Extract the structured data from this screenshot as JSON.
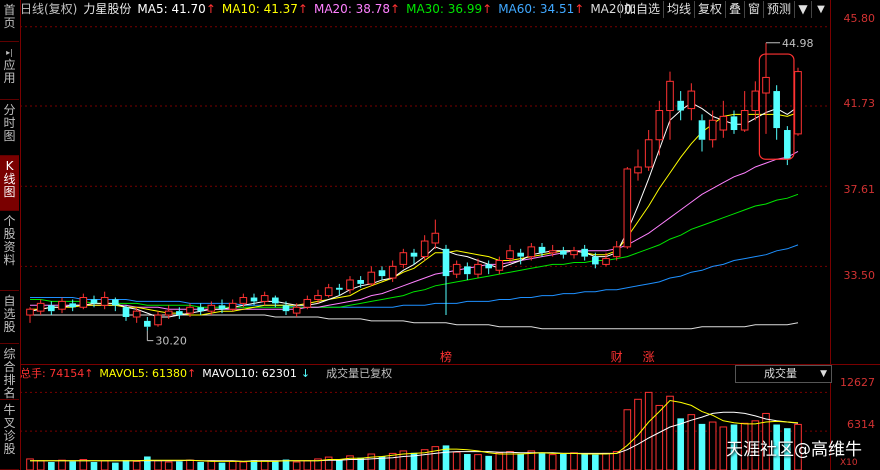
{
  "sidebar": {
    "items": [
      {
        "label": "首页",
        "active": false
      },
      {
        "label": "应用",
        "active": false,
        "prefix": "▸|"
      },
      {
        "label": "分时图",
        "active": false
      },
      {
        "label": "K线图",
        "active": true
      },
      {
        "label": "个股资料",
        "active": false
      },
      {
        "label": "自选股",
        "active": false
      },
      {
        "label": "综合排名",
        "active": false
      },
      {
        "label": "牛叉诊股",
        "active": false
      }
    ]
  },
  "header": {
    "period": "日线(复权)",
    "stock_name": "力星股份",
    "ma5": "MA5: 41.70",
    "ma10": "MA10: 41.37",
    "ma20": "MA20: 38.78",
    "ma30": "MA30: 36.99",
    "ma60": "MA60: 34.51",
    "ma200": "MA200:",
    "up_arrow": "↑"
  },
  "toolbar": {
    "buttons": [
      "加自选",
      "均线",
      "复权",
      "叠",
      "窗",
      "预测"
    ],
    "menu_icon": "▼"
  },
  "price_axis": {
    "labels": [
      "45.80",
      "41.73",
      "37.61",
      "33.50"
    ],
    "vol_labels": [
      "12627",
      "6314"
    ],
    "vol_unit": "X10"
  },
  "chart_annotations": {
    "high": "44.98",
    "low": "30.20",
    "markers": [
      "榜",
      "财",
      "涨"
    ]
  },
  "volume_header": {
    "total": "总手: 74154",
    "mavol5": "MAVOL5: 61380",
    "mavol10": "MAVOL10: 62301",
    "down_arrow": "↓",
    "note": "成交量已复权"
  },
  "volume_select": {
    "value": "成交量"
  },
  "watermark": "天涯社区@高维牛",
  "colors": {
    "up": "#ff3232",
    "down": "#54ffff",
    "ma5": "#ffffff",
    "ma10": "#ffff00",
    "ma20": "#ff80ff",
    "ma30": "#00e600",
    "ma60": "#1e90ff",
    "ma200": "#dcdcdc",
    "axis": "#d23232"
  },
  "chart_data": {
    "type": "candlestick",
    "ylim": [
      29.0,
      46.2
    ],
    "candles": [
      [
        31.0,
        31.3,
        30.6,
        31.4
      ],
      [
        31.2,
        31.6,
        31.0,
        31.8
      ],
      [
        31.5,
        31.2,
        31.0,
        31.7
      ],
      [
        31.3,
        31.7,
        31.1,
        31.9
      ],
      [
        31.6,
        31.4,
        31.2,
        31.8
      ],
      [
        31.4,
        31.9,
        31.3,
        32.1
      ],
      [
        31.8,
        31.6,
        31.4,
        32.0
      ],
      [
        31.5,
        31.9,
        31.3,
        32.2
      ],
      [
        31.8,
        31.5,
        31.2,
        31.9
      ],
      [
        31.4,
        30.9,
        30.7,
        31.5
      ],
      [
        30.9,
        31.2,
        30.6,
        31.4
      ],
      [
        30.7,
        30.4,
        30.2,
        30.9
      ],
      [
        30.5,
        31.0,
        30.4,
        31.2
      ],
      [
        31.0,
        31.2,
        30.8,
        31.5
      ],
      [
        31.2,
        31.0,
        30.8,
        31.4
      ],
      [
        31.1,
        31.4,
        30.9,
        31.6
      ],
      [
        31.4,
        31.2,
        31.0,
        31.6
      ],
      [
        31.2,
        31.5,
        31.0,
        31.7
      ],
      [
        31.5,
        31.3,
        31.1,
        31.8
      ],
      [
        31.3,
        31.6,
        31.2,
        31.8
      ],
      [
        31.6,
        31.9,
        31.4,
        32.1
      ],
      [
        31.9,
        31.7,
        31.5,
        32.1
      ],
      [
        31.7,
        32.0,
        31.5,
        32.2
      ],
      [
        31.9,
        31.6,
        31.4,
        32.0
      ],
      [
        31.5,
        31.2,
        31.0,
        31.7
      ],
      [
        31.1,
        31.4,
        30.9,
        31.6
      ],
      [
        31.4,
        31.8,
        31.3,
        32.0
      ],
      [
        31.8,
        32.0,
        31.6,
        32.3
      ],
      [
        32.0,
        32.4,
        31.9,
        32.6
      ],
      [
        32.4,
        32.3,
        32.0,
        32.6
      ],
      [
        32.3,
        32.8,
        32.1,
        33.0
      ],
      [
        32.8,
        32.6,
        32.4,
        33.0
      ],
      [
        32.6,
        33.2,
        32.5,
        33.5
      ],
      [
        33.3,
        33.0,
        32.8,
        33.5
      ],
      [
        32.9,
        33.5,
        32.7,
        33.8
      ],
      [
        33.6,
        34.2,
        33.4,
        34.4
      ],
      [
        34.2,
        34.0,
        33.6,
        34.4
      ],
      [
        34.0,
        34.8,
        33.8,
        35.1
      ],
      [
        34.7,
        35.2,
        34.4,
        35.9
      ],
      [
        34.4,
        33.0,
        31.0,
        34.6
      ],
      [
        33.1,
        33.6,
        32.9,
        33.8
      ],
      [
        33.5,
        33.1,
        32.8,
        33.7
      ],
      [
        33.1,
        33.6,
        32.9,
        33.9
      ],
      [
        33.6,
        33.4,
        33.1,
        33.8
      ],
      [
        33.3,
        33.8,
        33.1,
        34.0
      ],
      [
        33.9,
        34.3,
        33.7,
        34.6
      ],
      [
        34.2,
        34.0,
        33.6,
        34.4
      ],
      [
        34.0,
        34.5,
        33.8,
        34.7
      ],
      [
        34.5,
        34.2,
        34.0,
        34.7
      ],
      [
        34.2,
        34.3,
        34.0,
        34.6
      ],
      [
        34.3,
        34.1,
        33.9,
        34.5
      ],
      [
        34.1,
        34.3,
        33.9,
        34.5
      ],
      [
        34.4,
        34.0,
        33.8,
        34.6
      ],
      [
        34.0,
        33.6,
        33.4,
        34.2
      ],
      [
        33.6,
        33.9,
        33.5,
        34.2
      ],
      [
        34.0,
        34.5,
        33.8,
        34.8
      ],
      [
        34.5,
        38.5,
        34.4,
        38.6
      ],
      [
        38.3,
        38.6,
        37.9,
        39.5
      ],
      [
        38.6,
        40.0,
        38.4,
        40.5
      ],
      [
        40.0,
        41.5,
        39.2,
        42.0
      ],
      [
        41.5,
        43.0,
        40.0,
        43.5
      ],
      [
        42.0,
        41.5,
        41.0,
        42.5
      ],
      [
        41.6,
        42.5,
        41.0,
        42.9
      ],
      [
        41.0,
        40.0,
        39.4,
        41.3
      ],
      [
        40.0,
        41.0,
        39.6,
        41.5
      ],
      [
        40.5,
        41.2,
        40.1,
        42.0
      ],
      [
        41.2,
        40.5,
        40.3,
        41.5
      ],
      [
        40.5,
        41.5,
        40.4,
        42.5
      ],
      [
        41.5,
        42.5,
        41.0,
        43.0
      ],
      [
        42.4,
        43.2,
        40.3,
        44.98
      ],
      [
        42.5,
        40.6,
        40.0,
        42.8
      ],
      [
        40.5,
        39.0,
        38.7,
        40.7
      ],
      [
        40.3,
        43.5,
        40.2,
        43.7
      ]
    ],
    "ma5": [
      31.2,
      31.3,
      31.4,
      31.4,
      31.5,
      31.5,
      31.6,
      31.6,
      31.6,
      31.4,
      31.3,
      31.1,
      30.9,
      30.9,
      31.0,
      31.1,
      31.2,
      31.3,
      31.3,
      31.4,
      31.5,
      31.6,
      31.7,
      31.7,
      31.6,
      31.5,
      31.5,
      31.6,
      31.8,
      32.0,
      32.3,
      32.5,
      32.6,
      32.8,
      32.9,
      33.3,
      33.6,
      34.0,
      34.5,
      34.3,
      34.1,
      34.0,
      33.8,
      33.6,
      33.4,
      33.6,
      33.8,
      34.1,
      34.2,
      34.3,
      34.3,
      34.3,
      34.2,
      34.0,
      34.0,
      34.2,
      35.3,
      36.6,
      38.0,
      39.5,
      41.0,
      41.5,
      41.9,
      41.6,
      41.2,
      41.0,
      40.8,
      40.8,
      41.1,
      41.4,
      41.6,
      41.3,
      41.7
    ],
    "ma10": [
      31.3,
      31.3,
      31.4,
      31.4,
      31.4,
      31.5,
      31.5,
      31.5,
      31.5,
      31.4,
      31.4,
      31.3,
      31.2,
      31.1,
      31.1,
      31.0,
      31.0,
      31.1,
      31.2,
      31.2,
      31.3,
      31.4,
      31.5,
      31.5,
      31.5,
      31.5,
      31.6,
      31.7,
      31.8,
      31.9,
      32.0,
      32.3,
      32.5,
      32.7,
      32.9,
      33.2,
      33.4,
      33.8,
      34.2,
      34.2,
      34.3,
      34.2,
      34.1,
      34.0,
      33.8,
      33.8,
      33.9,
      34.0,
      34.1,
      34.2,
      34.3,
      34.3,
      34.2,
      34.1,
      34.1,
      34.3,
      35.0,
      35.8,
      36.6,
      37.5,
      38.3,
      39.1,
      39.8,
      40.4,
      40.8,
      41.2,
      41.3,
      41.3,
      41.3,
      41.3,
      41.3,
      41.2,
      41.4
    ],
    "ma20": [
      31.5,
      31.5,
      31.5,
      31.5,
      31.5,
      31.5,
      31.5,
      31.5,
      31.5,
      31.5,
      31.4,
      31.4,
      31.4,
      31.3,
      31.3,
      31.3,
      31.3,
      31.3,
      31.3,
      31.3,
      31.3,
      31.3,
      31.3,
      31.3,
      31.3,
      31.3,
      31.4,
      31.4,
      31.5,
      31.6,
      31.7,
      31.8,
      32.0,
      32.1,
      32.3,
      32.5,
      32.7,
      32.9,
      33.1,
      33.2,
      33.3,
      33.4,
      33.5,
      33.6,
      33.6,
      33.7,
      33.8,
      33.9,
      34.0,
      34.1,
      34.2,
      34.3,
      34.3,
      34.3,
      34.3,
      34.4,
      34.6,
      34.9,
      35.2,
      35.6,
      36.0,
      36.4,
      36.8,
      37.2,
      37.5,
      37.8,
      38.1,
      38.3,
      38.6,
      38.8,
      39.0,
      39.1,
      39.4
    ],
    "ma30": [
      31.8,
      31.8,
      31.7,
      31.7,
      31.7,
      31.7,
      31.6,
      31.6,
      31.6,
      31.6,
      31.6,
      31.5,
      31.5,
      31.5,
      31.5,
      31.5,
      31.4,
      31.4,
      31.4,
      31.4,
      31.4,
      31.4,
      31.4,
      31.4,
      31.4,
      31.4,
      31.4,
      31.4,
      31.4,
      31.4,
      31.5,
      31.6,
      31.7,
      31.8,
      31.9,
      32.0,
      32.2,
      32.3,
      32.5,
      32.6,
      32.7,
      32.8,
      32.9,
      33.0,
      33.1,
      33.2,
      33.3,
      33.4,
      33.5,
      33.6,
      33.6,
      33.7,
      33.7,
      33.8,
      33.8,
      33.9,
      34.0,
      34.2,
      34.4,
      34.6,
      34.9,
      35.1,
      35.4,
      35.6,
      35.8,
      36.0,
      36.2,
      36.4,
      36.6,
      36.7,
      36.9,
      37.0,
      37.2
    ],
    "ma60": [
      31.9,
      31.9,
      31.9,
      31.9,
      31.9,
      31.8,
      31.8,
      31.8,
      31.8,
      31.8,
      31.7,
      31.7,
      31.7,
      31.7,
      31.7,
      31.6,
      31.6,
      31.6,
      31.6,
      31.6,
      31.5,
      31.5,
      31.5,
      31.5,
      31.5,
      31.4,
      31.4,
      31.4,
      31.4,
      31.4,
      31.4,
      31.4,
      31.4,
      31.4,
      31.4,
      31.5,
      31.5,
      31.5,
      31.6,
      31.6,
      31.6,
      31.7,
      31.7,
      31.7,
      31.8,
      31.8,
      31.9,
      31.9,
      32.0,
      32.0,
      32.1,
      32.1,
      32.2,
      32.2,
      32.3,
      32.3,
      32.4,
      32.5,
      32.6,
      32.7,
      32.9,
      33.0,
      33.2,
      33.3,
      33.5,
      33.6,
      33.8,
      33.9,
      34.0,
      34.1,
      34.3,
      34.4,
      34.6
    ],
    "ma200": [
      31.0,
      31.0,
      31.0,
      31.0,
      31.0,
      31.0,
      31.0,
      31.0,
      31.0,
      31.0,
      31.0,
      31.0,
      31.0,
      31.0,
      31.0,
      31.0,
      31.0,
      31.0,
      31.0,
      31.0,
      31.0,
      31.0,
      31.0,
      30.9,
      30.9,
      30.9,
      30.9,
      30.9,
      30.8,
      30.8,
      30.8,
      30.8,
      30.7,
      30.7,
      30.7,
      30.7,
      30.6,
      30.6,
      30.6,
      30.6,
      30.5,
      30.5,
      30.5,
      30.5,
      30.4,
      30.4,
      30.4,
      30.4,
      30.3,
      30.3,
      30.3,
      30.3,
      30.3,
      30.3,
      30.3,
      30.3,
      30.3,
      30.3,
      30.3,
      30.3,
      30.3,
      30.3,
      30.3,
      30.4,
      30.4,
      30.4,
      30.4,
      30.4,
      30.5,
      30.5,
      30.5,
      30.5,
      30.6
    ],
    "volume": [
      1800,
      1500,
      1300,
      1600,
      1400,
      1700,
      1300,
      1500,
      1200,
      1600,
      1400,
      2200,
      1500,
      1300,
      1400,
      1600,
      1300,
      1500,
      1200,
      1400,
      1300,
      1600,
      1500,
      1400,
      1700,
      1300,
      1500,
      1800,
      2100,
      1700,
      2300,
      2000,
      2600,
      2200,
      2700,
      3100,
      2800,
      3300,
      3800,
      4000,
      2900,
      2600,
      2500,
      2300,
      2800,
      3000,
      2600,
      3100,
      2700,
      2500,
      2600,
      2800,
      2600,
      2500,
      2700,
      3000,
      9800,
      11500,
      12627,
      10500,
      12000,
      8400,
      9000,
      7500,
      7800,
      7000,
      7400,
      7600,
      8000,
      9200,
      7400,
      6800,
      7415
    ],
    "mavol5": [
      1500,
      1500,
      1500,
      1500,
      1500,
      1500,
      1500,
      1500,
      1500,
      1500,
      1500,
      1600,
      1600,
      1600,
      1600,
      1600,
      1500,
      1400,
      1400,
      1400,
      1400,
      1400,
      1400,
      1400,
      1500,
      1500,
      1500,
      1500,
      1700,
      1700,
      1900,
      1900,
      2100,
      2200,
      2400,
      2600,
      2700,
      2800,
      3100,
      3400,
      3400,
      3300,
      3100,
      2800,
      2600,
      2600,
      2600,
      2700,
      2800,
      2700,
      2700,
      2700,
      2600,
      2600,
      2600,
      2700,
      4000,
      5700,
      7800,
      9500,
      11300,
      11000,
      10500,
      9500,
      8900,
      8000,
      7700,
      7500,
      7500,
      7800,
      7900,
      7800,
      7700
    ],
    "mavol10": [
      1500,
      1500,
      1500,
      1500,
      1500,
      1500,
      1500,
      1500,
      1500,
      1500,
      1500,
      1500,
      1500,
      1500,
      1500,
      1600,
      1500,
      1500,
      1500,
      1500,
      1400,
      1500,
      1500,
      1500,
      1500,
      1500,
      1500,
      1500,
      1600,
      1600,
      1700,
      1700,
      1800,
      1900,
      2000,
      2200,
      2300,
      2500,
      2700,
      2900,
      3000,
      3000,
      3000,
      3000,
      2900,
      2900,
      2800,
      2800,
      2800,
      2800,
      2700,
      2700,
      2700,
      2700,
      2700,
      2700,
      3300,
      4200,
      5200,
      6100,
      7000,
      7500,
      8100,
      8600,
      9200,
      9400,
      9400,
      9200,
      8800,
      8300,
      8000,
      7800,
      7600
    ]
  }
}
